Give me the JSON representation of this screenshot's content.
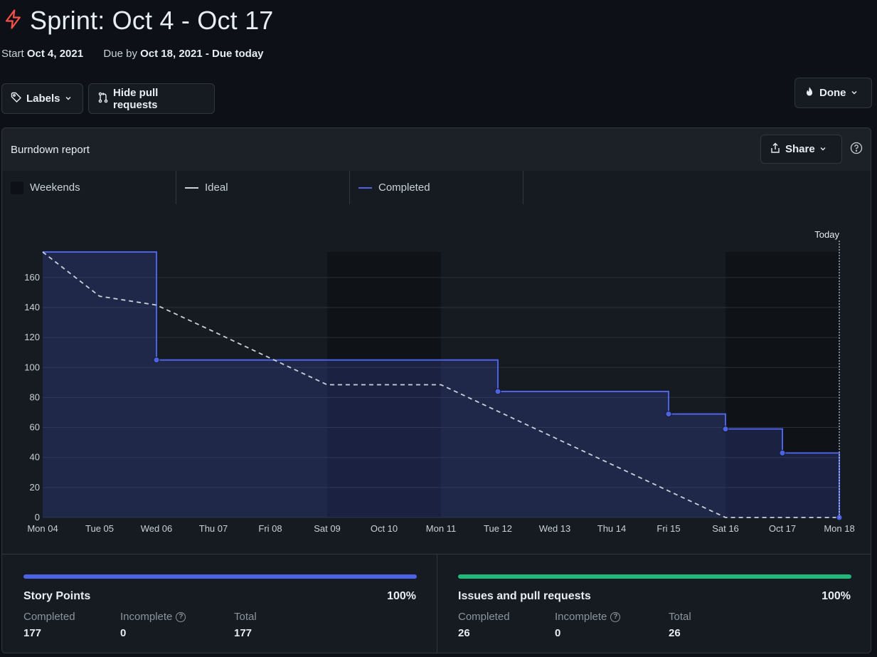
{
  "header": {
    "icon": "lightning-icon",
    "title": "Sprint: Oct 4 - Oct 17",
    "start_label": "Start",
    "start_date": "Oct 4, 2021",
    "due_label": "Due by",
    "due_date": "Oct 18, 2021 - Due today"
  },
  "toolbar": {
    "labels_button": "Labels",
    "hide_prs_button": "Hide pull requests",
    "done_button": "Done"
  },
  "report": {
    "title": "Burndown report",
    "share_button": "Share",
    "legend": {
      "weekends": "Weekends",
      "ideal": "Ideal",
      "completed": "Completed"
    }
  },
  "colors": {
    "completed": "#4c63e8",
    "ideal": "#c9d1d9",
    "issues_bar": "#1fb97a",
    "danger_icon": "#f85149"
  },
  "chart_data": {
    "type": "line",
    "x": [
      "Mon 04",
      "Tue 05",
      "Wed 06",
      "Thu 07",
      "Fri 08",
      "Sat 09",
      "Oct 10",
      "Mon 11",
      "Tue 12",
      "Wed 13",
      "Thu 14",
      "Fri 15",
      "Sat 16",
      "Oct 17",
      "Mon 18"
    ],
    "ylim": [
      0,
      177
    ],
    "yticks": [
      0,
      20,
      40,
      60,
      80,
      100,
      120,
      140,
      160
    ],
    "grid": true,
    "weekends": [
      [
        5,
        7
      ],
      [
        12,
        14
      ]
    ],
    "today_label": "Today",
    "series": [
      {
        "name": "Completed",
        "style": "step",
        "values": [
          177,
          177,
          105,
          105,
          105,
          105,
          105,
          105,
          84,
          84,
          84,
          69,
          59,
          43,
          0
        ]
      },
      {
        "name": "Ideal",
        "style": "dashed",
        "values": [
          177,
          147.5,
          141.6,
          124,
          106.2,
          88.5,
          88.5,
          88.5,
          70.8,
          53.1,
          35.4,
          17.7,
          0,
          0,
          0
        ]
      }
    ]
  },
  "stats": {
    "story_points": {
      "title": "Story Points",
      "percent": "100%",
      "completed_label": "Completed",
      "completed": "177",
      "incomplete_label": "Incomplete",
      "incomplete": "0",
      "total_label": "Total",
      "total": "177",
      "progress": 1.0
    },
    "issues": {
      "title": "Issues and pull requests",
      "percent": "100%",
      "completed_label": "Completed",
      "completed": "26",
      "incomplete_label": "Incomplete",
      "incomplete": "0",
      "total_label": "Total",
      "total": "26",
      "progress": 1.0
    }
  }
}
